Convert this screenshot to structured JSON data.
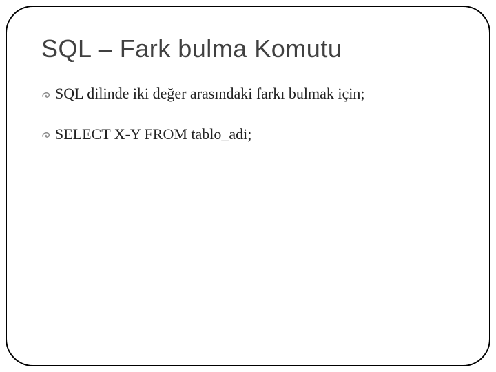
{
  "slide": {
    "title": "SQL – Fark bulma Komutu",
    "bullets": [
      {
        "text": "SQL dilinde iki değer arasındaki farkı bulmak için;"
      },
      {
        "text": "SELECT X-Y FROM tablo_adi;"
      }
    ]
  }
}
